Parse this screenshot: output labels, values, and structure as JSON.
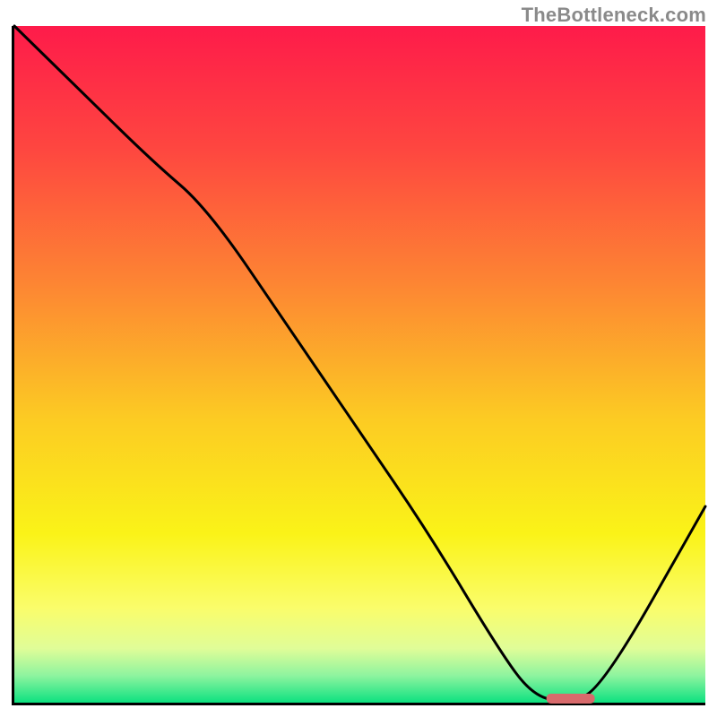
{
  "watermark": "TheBottleneck.com",
  "chart_data": {
    "type": "line",
    "title": "",
    "xlabel": "",
    "ylabel": "",
    "xlim": [
      0,
      100
    ],
    "ylim": [
      0,
      100
    ],
    "series": [
      {
        "name": "curve",
        "x": [
          0,
          10,
          20,
          28,
          40,
          50,
          60,
          70,
          75,
          80,
          85,
          100
        ],
        "y": [
          100,
          90,
          80,
          73,
          55,
          40,
          25,
          8,
          1,
          0,
          2,
          29
        ]
      }
    ],
    "marker": {
      "x_start": 77,
      "x_end": 84,
      "y": 0.6
    },
    "gradient_stops": [
      {
        "offset": 0.0,
        "color": "#fe1b4a"
      },
      {
        "offset": 0.18,
        "color": "#fe4640"
      },
      {
        "offset": 0.38,
        "color": "#fd8533"
      },
      {
        "offset": 0.58,
        "color": "#fccb23"
      },
      {
        "offset": 0.75,
        "color": "#faf318"
      },
      {
        "offset": 0.86,
        "color": "#fafd6b"
      },
      {
        "offset": 0.92,
        "color": "#e0fd98"
      },
      {
        "offset": 0.96,
        "color": "#8ef49f"
      },
      {
        "offset": 1.0,
        "color": "#0de180"
      }
    ]
  }
}
